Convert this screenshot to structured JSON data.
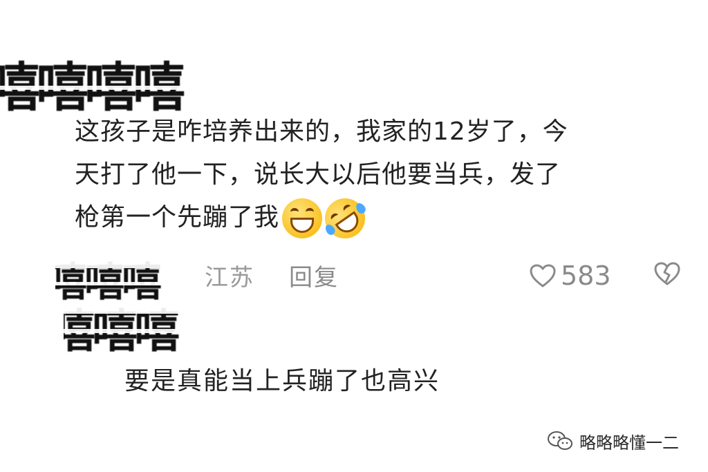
{
  "censor": {
    "top_user": "嘻嘻嘻嘻",
    "location_user_top": "嘻嘻嘻",
    "reply_user": "嘻嘻嘻"
  },
  "comment": {
    "lines": [
      "这孩子是咋培养出来的，我家的12岁了，今",
      "天打了他一下，说长大以后他要当兵，发了",
      "枪第一个先蹦了我"
    ],
    "emojis": [
      "grinning-face-icon",
      "rolling-on-floor-laughing-icon"
    ],
    "location": "江苏",
    "reply_label": "回复",
    "like_count": "583"
  },
  "reply": {
    "text": "要是真能当上兵蹦了也高兴"
  },
  "watermark": {
    "text": "略略略懂一二"
  }
}
